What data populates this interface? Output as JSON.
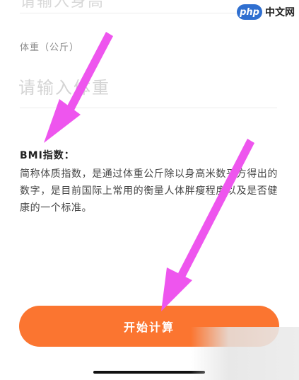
{
  "form": {
    "height_input_partial": "请输入身高",
    "weight_label": "体重（公斤）",
    "weight_placeholder": "请输入体重"
  },
  "bmi_info": {
    "title": "BMI指数：",
    "description": "简称体质指数，是通过体重公斤除以身高米数平方得出的数字，是目前国际上常用的衡量人体胖瘦程度以及是否健康的一个标准。"
  },
  "actions": {
    "start_button": "开始计算"
  },
  "watermark": {
    "logo": "php",
    "site": "中文网"
  },
  "colors": {
    "button": "#fb7530",
    "arrow_annotation": "#ee55ee"
  }
}
